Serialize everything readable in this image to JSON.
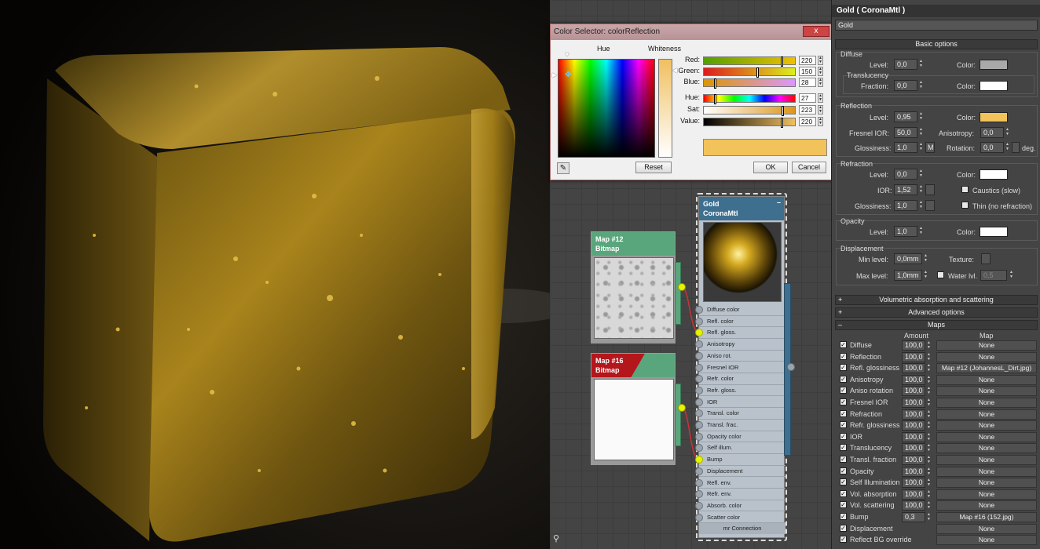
{
  "dialog": {
    "title": "Color Selector: colorReflection",
    "close": "x",
    "hue_label": "Hue",
    "whiteness_label": "Whiteness",
    "channels": [
      {
        "label": "Red:",
        "value": "220",
        "level": 0.86,
        "gradient": "linear-gradient(90deg,#52a000,#f0c000)"
      },
      {
        "label": "Green:",
        "value": "150",
        "level": 0.59,
        "gradient": "linear-gradient(90deg,#dc1c1c,#dcf01c)"
      },
      {
        "label": "Blue:",
        "value": "28",
        "level": 0.11,
        "gradient": "linear-gradient(90deg,#dc9600,#dc96ff)"
      },
      {
        "label": "Hue:",
        "value": "27",
        "level": 0.11,
        "gradient": "linear-gradient(90deg,#f00,#ff0,#0f0,#0ff,#00f,#f0f,#f00)"
      },
      {
        "label": "Sat:",
        "value": "223",
        "level": 0.87,
        "gradient": "linear-gradient(90deg,#ffffff,#dc961c)"
      },
      {
        "label": "Value:",
        "value": "220",
        "level": 0.86,
        "gradient": "linear-gradient(90deg,#000000,#f0c060)"
      }
    ],
    "swatch_color": "#f2c35a",
    "reset": "Reset",
    "ok": "OK",
    "cancel": "Cancel"
  },
  "nodes": {
    "map12": {
      "title1": "Map #12",
      "title2": "Bitmap"
    },
    "map16": {
      "title1": "Map #16",
      "title2": "Bitmap"
    },
    "gold": {
      "title1": "Gold",
      "title2": "CoronaMtl",
      "slots": [
        {
          "label": "Diffuse color",
          "connected": false
        },
        {
          "label": "Refl. color",
          "connected": false
        },
        {
          "label": "Refl. gloss.",
          "connected": true
        },
        {
          "label": "Anisotropy",
          "connected": false
        },
        {
          "label": "Aniso rot.",
          "connected": false
        },
        {
          "label": "Fresnel IOR",
          "connected": false
        },
        {
          "label": "Refr. color",
          "connected": false
        },
        {
          "label": "Refr. gloss.",
          "connected": false
        },
        {
          "label": "IOR",
          "connected": false
        },
        {
          "label": "Transl. color",
          "connected": false
        },
        {
          "label": "Transl. frac.",
          "connected": false
        },
        {
          "label": "Opacity color",
          "connected": false
        },
        {
          "label": "Self illum.",
          "connected": false
        },
        {
          "label": "Bump",
          "connected": true
        },
        {
          "label": "Displacement",
          "connected": false
        },
        {
          "label": "Refl. env.",
          "connected": false
        },
        {
          "label": "Refr. env.",
          "connected": false
        },
        {
          "label": "Absorb. color",
          "connected": false
        },
        {
          "label": "Scatter color",
          "connected": false
        }
      ],
      "mr": "mr Connection"
    }
  },
  "panel": {
    "material_title": "Gold  ( CoronaMtl )",
    "name_field": "Gold",
    "basic_options": "Basic options",
    "diffuse": {
      "header": "Diffuse",
      "level_label": "Level:",
      "level": "0,0",
      "color_label": "Color:",
      "color": "#a9a9a9",
      "translucency": "Translucency",
      "fraction_label": "Fraction:",
      "fraction": "0,0",
      "transl_color": "#ffffff"
    },
    "reflection": {
      "header": "Reflection",
      "level_label": "Level:",
      "level": "0,95",
      "color_label": "Color:",
      "color": "#f2c35a",
      "fresnel_label": "Fresnel IOR:",
      "fresnel": "50,0",
      "aniso_label": "Anisotropy:",
      "aniso": "0,0",
      "gloss_label": "Glossiness:",
      "gloss": "1,0",
      "m": "M",
      "rot_label": "Rotation:",
      "rot": "0,0",
      "deg": "deg."
    },
    "refraction": {
      "header": "Refraction",
      "level_label": "Level:",
      "level": "0,0",
      "color_label": "Color:",
      "color": "#ffffff",
      "ior_label": "IOR:",
      "ior": "1,52",
      "caustics": "Caustics (slow)",
      "gloss_label": "Glossiness:",
      "gloss": "1,0",
      "thin": "Thin (no refraction)"
    },
    "opacity": {
      "header": "Opacity",
      "level_label": "Level:",
      "level": "1,0",
      "color_label": "Color:",
      "color": "#ffffff"
    },
    "displacement": {
      "header": "Displacement",
      "min_label": "Min level:",
      "min": "0,0mm",
      "texture_label": "Texture:",
      "max_label": "Max level:",
      "max": "1,0mm",
      "water_label": "Water lvl.",
      "water": "0,5"
    },
    "rollouts": {
      "volumetric": "Volumetric absorption and scattering",
      "advanced": "Advanced options",
      "maps": "Maps"
    },
    "maps_header": {
      "amount": "Amount",
      "map": "Map"
    },
    "maps": [
      {
        "label": "Diffuse",
        "amount": "100,0",
        "map": "None"
      },
      {
        "label": "Reflection",
        "amount": "100,0",
        "map": "None"
      },
      {
        "label": "Refl. glossiness",
        "amount": "100,0",
        "map": "Map #12 (JohannesL_Dirt.jpg)"
      },
      {
        "label": "Anisotropy",
        "amount": "100,0",
        "map": "None"
      },
      {
        "label": "Aniso rotation",
        "amount": "100,0",
        "map": "None"
      },
      {
        "label": "Fresnel IOR",
        "amount": "100,0",
        "map": "None"
      },
      {
        "label": "Refraction",
        "amount": "100,0",
        "map": "None"
      },
      {
        "label": "Refr. glossiness",
        "amount": "100,0",
        "map": "None"
      },
      {
        "label": "IOR",
        "amount": "100,0",
        "map": "None"
      },
      {
        "label": "Translucency",
        "amount": "100,0",
        "map": "None"
      },
      {
        "label": "Transl. fraction",
        "amount": "100,0",
        "map": "None"
      },
      {
        "label": "Opacity",
        "amount": "100,0",
        "map": "None"
      },
      {
        "label": "Self Illumination",
        "amount": "100,0",
        "map": "None"
      },
      {
        "label": "Vol. absorption",
        "amount": "100,0",
        "map": "None"
      },
      {
        "label": "Vol. scattering",
        "amount": "100,0",
        "map": "None"
      },
      {
        "label": "Bump",
        "amount": "0,3",
        "map": "Map #16 (152.jpg)"
      },
      {
        "label": "Displacement",
        "amount": "",
        "map": "None"
      },
      {
        "label": "Reflect BG override",
        "amount": "",
        "map": "None"
      }
    ]
  }
}
